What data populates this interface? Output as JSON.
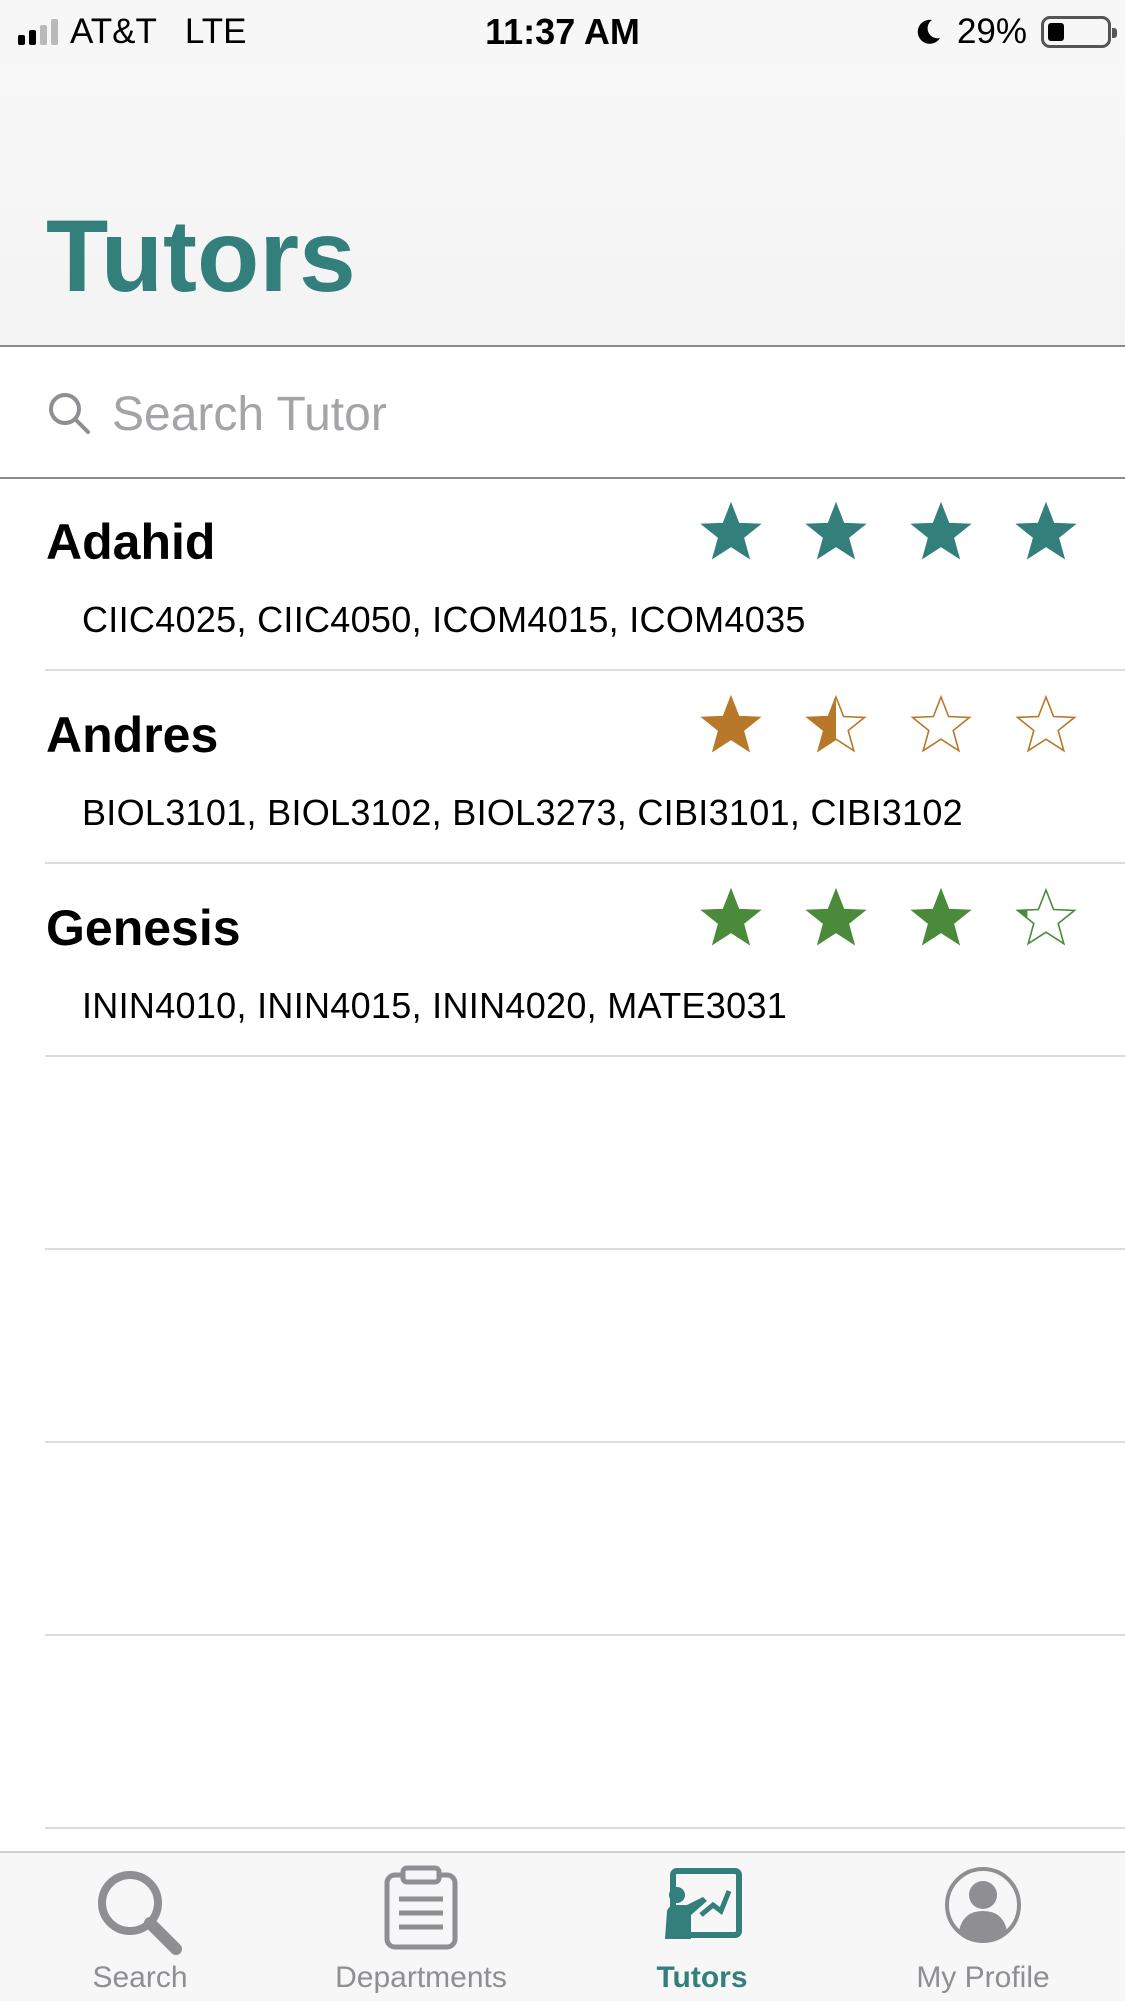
{
  "status_bar": {
    "carrier": "AT&T",
    "network": "LTE",
    "time": "11:37 AM",
    "battery": "29%",
    "battery_level": 0.29,
    "signal_bars": 2
  },
  "header": {
    "title": "Tutors"
  },
  "search": {
    "placeholder": "Search Tutor",
    "value": ""
  },
  "tutors": [
    {
      "name": "Adahid",
      "courses": "CIIC4025, CIIC4050, ICOM4015, ICOM4035",
      "rating": 4,
      "star_color": "#327f7c"
    },
    {
      "name": "Andres",
      "courses": "BIOL3101, BIOL3102, BIOL3273, CIBI3101, CIBI3102",
      "rating": 1.5,
      "star_color": "#b8782a"
    },
    {
      "name": "Genesis",
      "courses": "ININ4010, ININ4015, ININ4020, MATE3031",
      "rating": 3.2,
      "star_color": "#4a8a3a"
    }
  ],
  "max_rating": 4,
  "tab_bar": {
    "tabs": [
      {
        "label": "Search",
        "icon": "search-icon",
        "active": false
      },
      {
        "label": "Departments",
        "icon": "clipboard-icon",
        "active": false
      },
      {
        "label": "Tutors",
        "icon": "tutor-board-icon",
        "active": true
      },
      {
        "label": "My Profile",
        "icon": "profile-icon",
        "active": false
      }
    ]
  },
  "colors": {
    "accent": "#327f7c",
    "inactive": "#8e8e93"
  }
}
